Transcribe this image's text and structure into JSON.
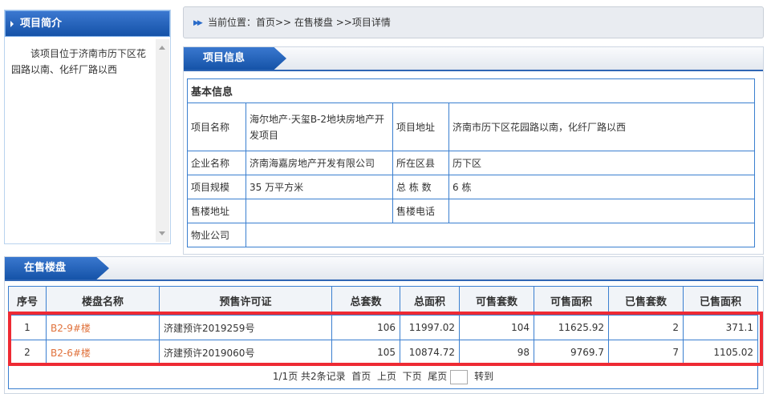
{
  "intro": {
    "title": "项目简介",
    "text": "该项目位于济南市历下区花园路以南、化纤厂路以西"
  },
  "breadcrumb": "当前位置：首页>> 在售楼盘 >>项目详情",
  "info": {
    "title": "项目信息",
    "section": "基本信息",
    "rows": [
      {
        "l1": "项目名称",
        "v1": "海尔地产·天玺B-2地块房地产开发项目",
        "l2": "项目地址",
        "v2": "济南市历下区花园路以南，化纤厂路以西"
      },
      {
        "l1": "企业名称",
        "v1": "济南海嘉房地产开发有限公司",
        "l2": "所在区县",
        "v2": "历下区"
      },
      {
        "l1": "项目规模",
        "v1": "35 万平方米",
        "l2": "总 栋 数",
        "v2": "6 栋"
      },
      {
        "l1": "售楼地址",
        "v1": "",
        "l2": "售楼电话",
        "v2": ""
      },
      {
        "l1": "物业公司",
        "v1": ""
      }
    ]
  },
  "sale": {
    "title": "在售楼盘",
    "headers": [
      "序号",
      "楼盘名称",
      "预售许可证",
      "总套数",
      "总面积",
      "可售套数",
      "可售面积",
      "已售套数",
      "已售面积"
    ],
    "rows": [
      [
        "1",
        "B2-9#楼",
        "济建预许2019259号",
        "106",
        "11997.02",
        "104",
        "11625.92",
        "2",
        "371.1"
      ],
      [
        "2",
        "B2-6#楼",
        "济建预许2019060号",
        "105",
        "10874.72",
        "98",
        "9769.7",
        "7",
        "1105.02"
      ]
    ],
    "pager": {
      "info": "1/1页 共2条记录",
      "first": "首页",
      "prev": "上页",
      "next": "下页",
      "last": "尾页",
      "goto": "转到"
    }
  }
}
